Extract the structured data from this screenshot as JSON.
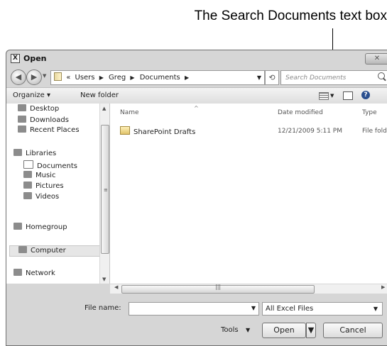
{
  "callout": {
    "text": "The Search Documents text box"
  },
  "window": {
    "title": "Open",
    "app_icon": "excel-icon"
  },
  "navigation": {
    "breadcrumbs": [
      "Users",
      "Greg",
      "Documents"
    ],
    "prefix": "«",
    "search_placeholder": "Search Documents"
  },
  "toolbar": {
    "organize_label": "Organize ▾",
    "new_folder_label": "New folder"
  },
  "nav_pane": {
    "favorites": [
      "Desktop",
      "Downloads",
      "Recent Places"
    ],
    "libraries_label": "Libraries",
    "library_items": [
      "Documents",
      "Music",
      "Pictures",
      "Videos"
    ],
    "homegroup_label": "Homegroup",
    "computer_label": "Computer",
    "network_label": "Network"
  },
  "file_list": {
    "columns": {
      "name": "Name",
      "date": "Date modified",
      "type": "Type"
    },
    "rows": [
      {
        "name": "SharePoint Drafts",
        "date": "12/21/2009 5:11 PM",
        "type": "File folder"
      }
    ]
  },
  "bottom": {
    "file_name_label": "File name:",
    "file_name_value": "",
    "filter_value": "All Excel Files",
    "tools_label": "Tools",
    "open_label": "Open",
    "cancel_label": "Cancel"
  }
}
